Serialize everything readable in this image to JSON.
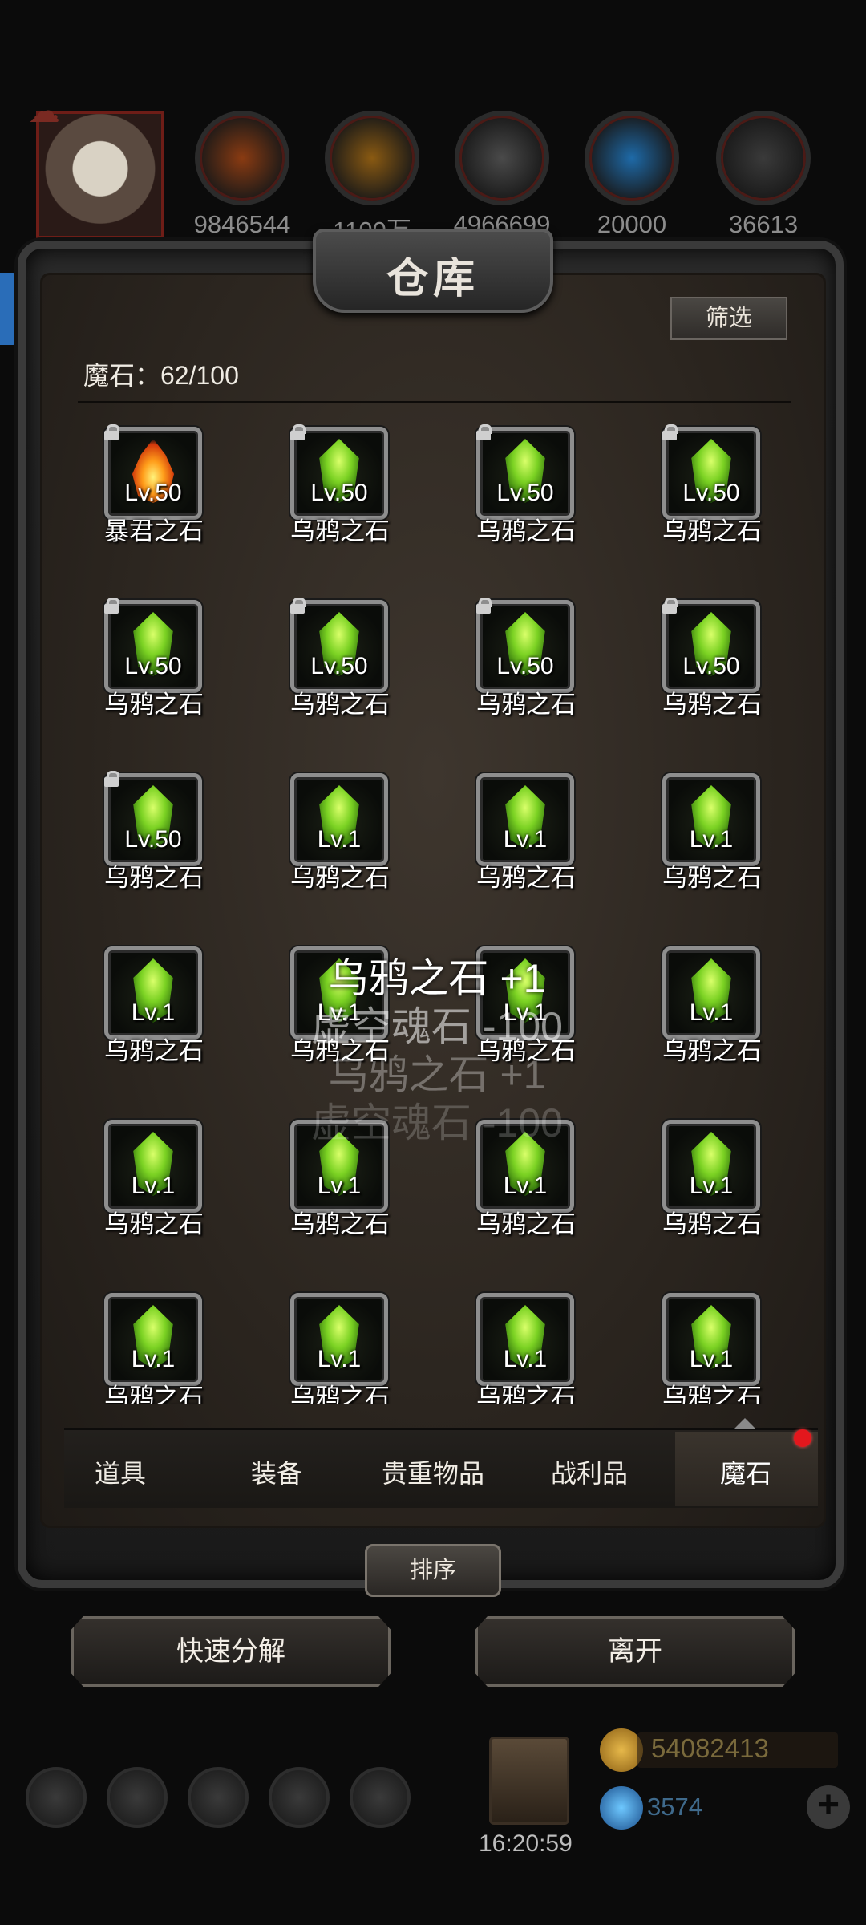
{
  "resources": [
    {
      "icon": "meat-icon",
      "value": "9846544"
    },
    {
      "icon": "wood-icon",
      "value": "1100万"
    },
    {
      "icon": "iron-icon",
      "value": "4966699"
    },
    {
      "icon": "crystal-icon",
      "value": "20000"
    },
    {
      "icon": "ore-icon",
      "value": "36613"
    }
  ],
  "panel": {
    "title": "仓库",
    "filter_label": "筛选",
    "capacity_label": "魔石：62/100"
  },
  "items": [
    {
      "name": "暴君之石",
      "level": "Lv.50",
      "locked": true,
      "type": "fire"
    },
    {
      "name": "乌鸦之石",
      "level": "Lv.50",
      "locked": true,
      "type": "green"
    },
    {
      "name": "乌鸦之石",
      "level": "Lv.50",
      "locked": true,
      "type": "green"
    },
    {
      "name": "乌鸦之石",
      "level": "Lv.50",
      "locked": true,
      "type": "green"
    },
    {
      "name": "乌鸦之石",
      "level": "Lv.50",
      "locked": true,
      "type": "green"
    },
    {
      "name": "乌鸦之石",
      "level": "Lv.50",
      "locked": true,
      "type": "green"
    },
    {
      "name": "乌鸦之石",
      "level": "Lv.50",
      "locked": true,
      "type": "green"
    },
    {
      "name": "乌鸦之石",
      "level": "Lv.50",
      "locked": true,
      "type": "green"
    },
    {
      "name": "乌鸦之石",
      "level": "Lv.50",
      "locked": true,
      "type": "green"
    },
    {
      "name": "乌鸦之石",
      "level": "Lv.1",
      "locked": false,
      "type": "green"
    },
    {
      "name": "乌鸦之石",
      "level": "Lv.1",
      "locked": false,
      "type": "green"
    },
    {
      "name": "乌鸦之石",
      "level": "Lv.1",
      "locked": false,
      "type": "green"
    },
    {
      "name": "乌鸦之石",
      "level": "Lv.1",
      "locked": false,
      "type": "green"
    },
    {
      "name": "乌鸦之石",
      "level": "Lv.1",
      "locked": false,
      "type": "green"
    },
    {
      "name": "乌鸦之石",
      "level": "Lv.1",
      "locked": false,
      "type": "green"
    },
    {
      "name": "乌鸦之石",
      "level": "Lv.1",
      "locked": false,
      "type": "green"
    },
    {
      "name": "乌鸦之石",
      "level": "Lv.1",
      "locked": false,
      "type": "green"
    },
    {
      "name": "乌鸦之石",
      "level": "Lv.1",
      "locked": false,
      "type": "green"
    },
    {
      "name": "乌鸦之石",
      "level": "Lv.1",
      "locked": false,
      "type": "green"
    },
    {
      "name": "乌鸦之石",
      "level": "Lv.1",
      "locked": false,
      "type": "green"
    },
    {
      "name": "乌鸦之石",
      "level": "Lv.1",
      "locked": false,
      "type": "green"
    },
    {
      "name": "乌鸦之石",
      "level": "Lv.1",
      "locked": false,
      "type": "green"
    },
    {
      "name": "乌鸦之石",
      "level": "Lv.1",
      "locked": false,
      "type": "green"
    },
    {
      "name": "乌鸦之石",
      "level": "Lv.1",
      "locked": false,
      "type": "green"
    }
  ],
  "notifications": [
    "乌鸦之石 +1",
    "虚空魂石 -100",
    "乌鸦之石 +1",
    "虚空魂石 -100"
  ],
  "tabs": [
    {
      "label": "道具",
      "active": false
    },
    {
      "label": "装备",
      "active": false
    },
    {
      "label": "贵重物品",
      "active": false
    },
    {
      "label": "战利品",
      "active": false
    },
    {
      "label": "魔石",
      "active": true
    }
  ],
  "actions": {
    "sort_label": "排序",
    "quick_decompose_label": "快速分解",
    "leave_label": "离开"
  },
  "hud": {
    "time": "16:20:59",
    "gold": "54082413",
    "gems": "3574"
  }
}
